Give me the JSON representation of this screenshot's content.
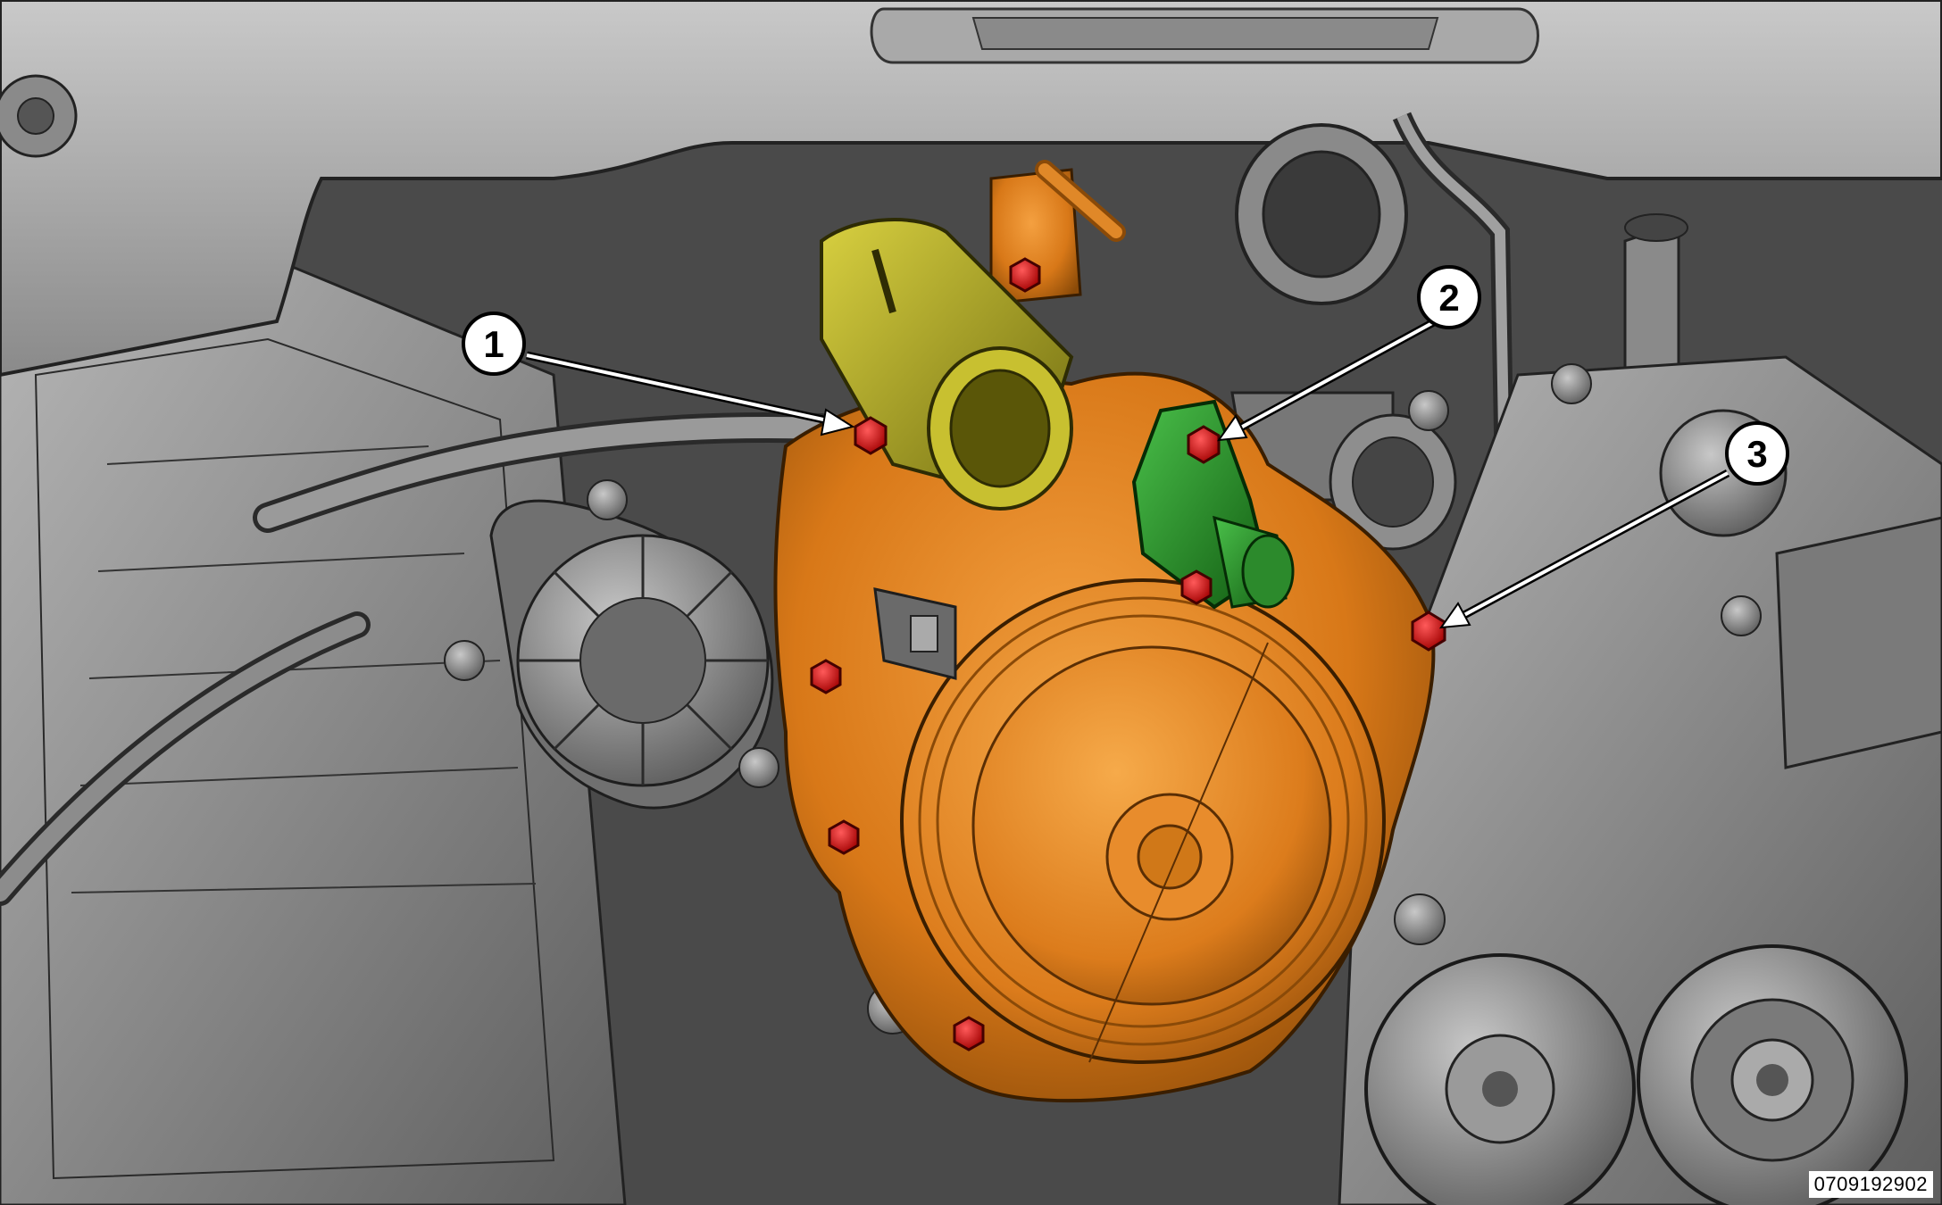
{
  "figure": {
    "callouts": [
      {
        "number": "1"
      },
      {
        "number": "2"
      },
      {
        "number": "3"
      }
    ],
    "figure_id": "0709192902",
    "colors": {
      "background": "#3b3b3b",
      "engine_gray": "#8e8e8e",
      "pump_orange": "#e0841e",
      "bolt_red": "#e01010",
      "fitting_yellow": "#b8b020",
      "fitting_green": "#2a9a2a"
    },
    "components": [
      "engine-cover",
      "timing-cover",
      "vacuum-pump",
      "water-pump",
      "water-pump-pulley",
      "mounting-bolts",
      "coolant-outlet-fitting",
      "coolant-bypass-fitting",
      "idler-pulleys"
    ]
  }
}
